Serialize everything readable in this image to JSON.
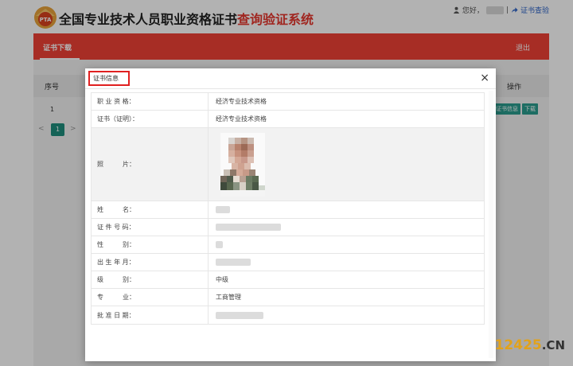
{
  "header": {
    "logo_text": "PTA",
    "title_main": "全国专业技术人员职业资格证书",
    "title_accent": "查询验证系统",
    "greeting": "您好，",
    "separator": "|",
    "verify_link": "证书查验"
  },
  "nav": {
    "tab_label": "证书下载",
    "logout_label": "退出"
  },
  "table": {
    "col_index": "序号",
    "col_operation": "操作",
    "row_index": "1",
    "btn_cert_info": "证书信息",
    "btn_download": "下载"
  },
  "pagination": {
    "prev": "<",
    "current": "1",
    "next": ">"
  },
  "modal": {
    "title": "证书信息",
    "close": "×",
    "rows": [
      {
        "label": "职 业 资 格：",
        "value": "经济专业技术资格"
      },
      {
        "label": "证书（证明）：",
        "value": "经济专业技术资格"
      },
      {
        "label": "照　　　片：",
        "value": ""
      },
      {
        "label": "姓　　　名：",
        "value": ""
      },
      {
        "label": "证 件 号 码：",
        "value": ""
      },
      {
        "label": "性　　　别：",
        "value": ""
      },
      {
        "label": "出 生 年 月：",
        "value": ""
      },
      {
        "label": "级　　　别：",
        "value": "中级"
      },
      {
        "label": "专　　　业：",
        "value": "工商管理"
      },
      {
        "label": "批 准 日 期：",
        "value": ""
      }
    ]
  },
  "watermark": {
    "number": "12425",
    "suffix": ".CN"
  },
  "colors": {
    "brand_red": "#ef4136",
    "accent_red": "#e5372e",
    "button_teal": "#2a9d8f",
    "link_blue": "#2d63c8"
  }
}
